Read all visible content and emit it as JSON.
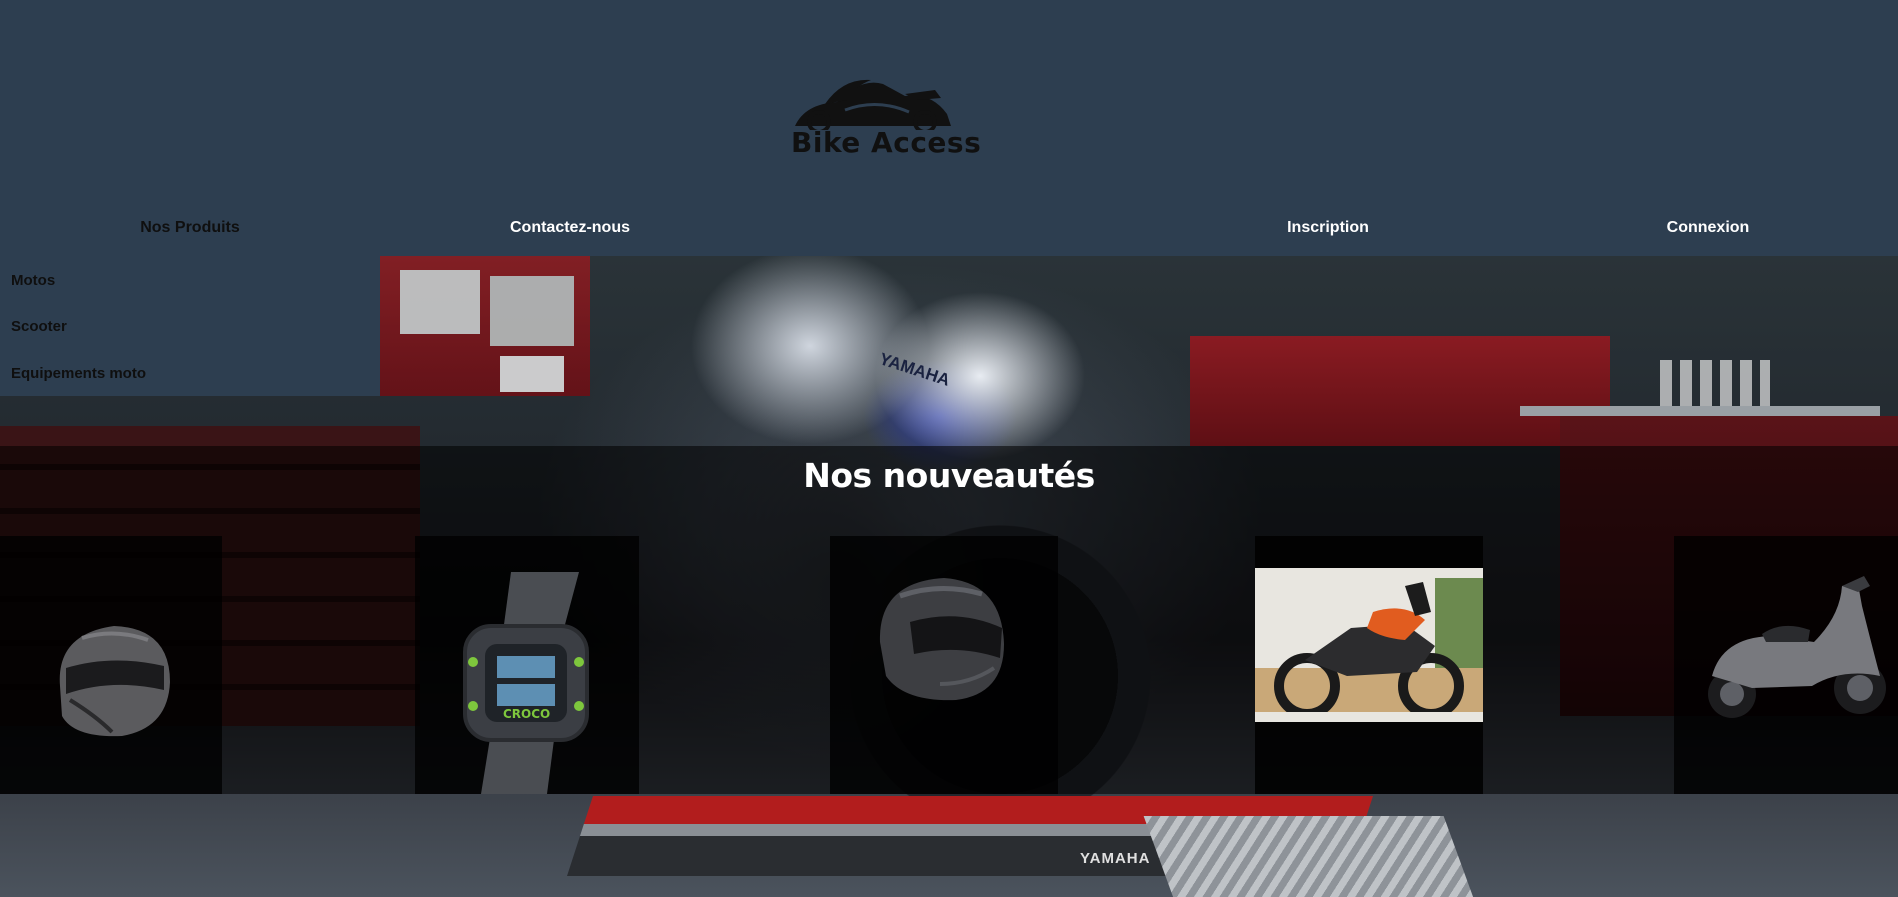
{
  "brand": {
    "name": "Bike Access"
  },
  "nav": {
    "products": "Nos Produits",
    "contact": "Contactez-nous",
    "signup": "Inscription",
    "login": "Connexion"
  },
  "dropdown": {
    "items": [
      "Motos",
      "Scooter",
      "Equipements moto"
    ]
  },
  "hero": {
    "bike_text": "YAMAHA",
    "lift_text": "YAMAHA"
  },
  "news": {
    "title": "Nos nouveautés",
    "products": [
      {
        "name": "helmet-retro-black",
        "icon": "helmet-icon"
      },
      {
        "name": "digital-watch",
        "icon": "watch-icon",
        "brand_text": "CROCO"
      },
      {
        "name": "helmet-modular-black",
        "icon": "helmet-icon"
      },
      {
        "name": "adventure-motorcycle-orange",
        "icon": "motorcycle-icon"
      },
      {
        "name": "maxi-scooter-grey",
        "icon": "scooter-icon"
      }
    ]
  },
  "colors": {
    "header_bg": "#2d3e50",
    "accent_red": "#b21d1d",
    "text_light": "#ffffff",
    "text_dark": "#0f0f0f"
  }
}
